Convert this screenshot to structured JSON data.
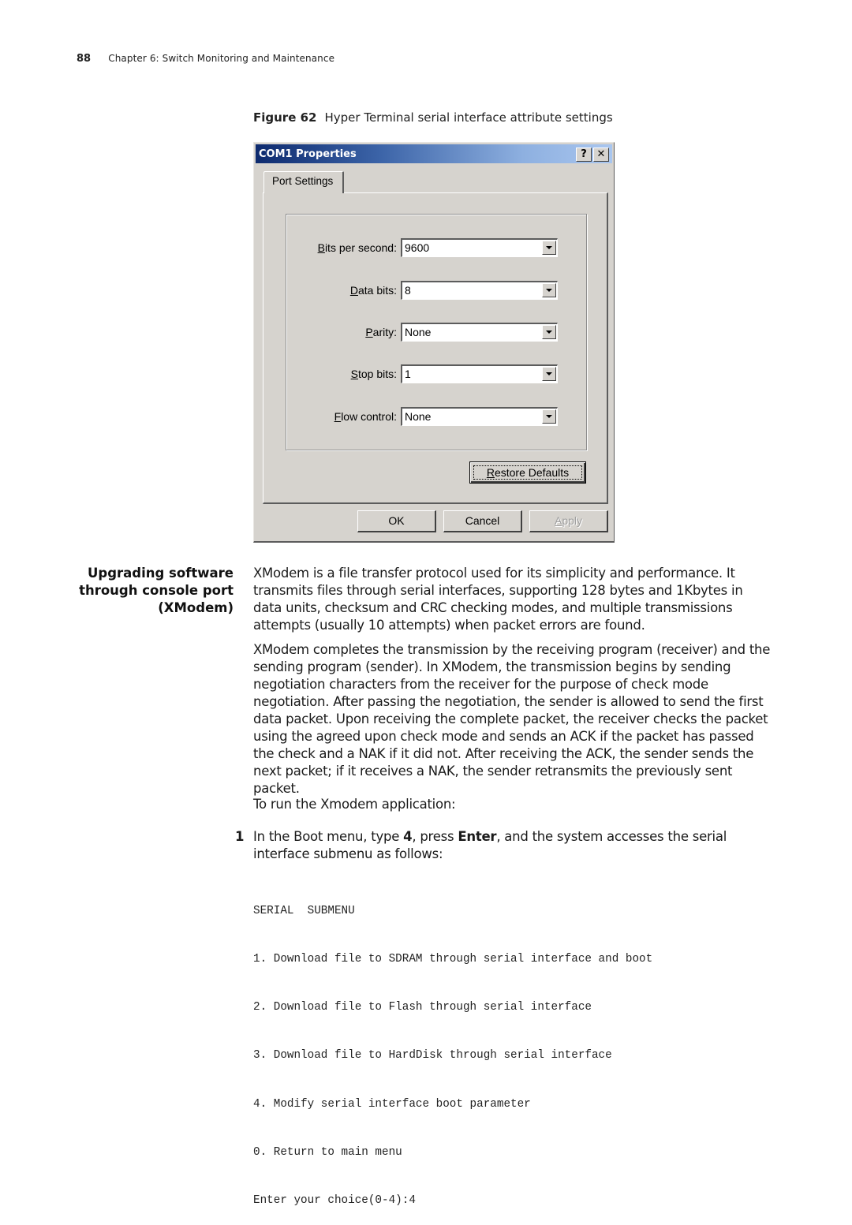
{
  "header": {
    "page_number": "88",
    "chapter": "Chapter 6: Switch Monitoring and Maintenance"
  },
  "figure": {
    "label": "Figure 62",
    "caption": "Hyper Terminal serial interface attribute settings"
  },
  "dialog": {
    "title": "COM1 Properties",
    "help_button": "?",
    "close_button": "✕",
    "tab_label": "Port Settings",
    "fields": [
      {
        "label_accel": "B",
        "label_rest": "its per second:",
        "value": "9600"
      },
      {
        "label_accel": "D",
        "label_rest": "ata bits:",
        "value": "8"
      },
      {
        "label_accel": "P",
        "label_rest": "arity:",
        "value": "None"
      },
      {
        "label_accel": "S",
        "label_rest": "top bits:",
        "value": "1"
      },
      {
        "label_accel": "F",
        "label_rest": "low control:",
        "value": "None"
      }
    ],
    "restore_defaults": {
      "accel": "R",
      "rest": "estore Defaults"
    },
    "ok_label": "OK",
    "cancel_label": "Cancel",
    "apply": {
      "accel": "A",
      "rest": "pply",
      "disabled": true
    }
  },
  "section": {
    "heading_lines": [
      "Upgrading software",
      "through console port",
      "(XModem)"
    ],
    "paragraph1": "XModem is a file transfer protocol used for its simplicity and performance. It transmits files through serial interfaces, supporting 128 bytes and 1Kbytes in data units, checksum and CRC checking modes, and multiple transmissions attempts (usually 10 attempts) when packet errors are found.",
    "paragraph2": "XModem completes the transmission by the receiving program (receiver) and the sending program (sender). In XModem, the transmission begins by sending negotiation characters from the receiver for the purpose of check mode negotiation. After passing the negotiation, the sender is allowed to send the first data packet. Upon receiving the complete packet, the receiver checks the packet using the agreed upon check mode and sends an ACK if the packet has passed the check and a NAK if it did not. After receiving the ACK, the sender sends the next packet; if it receives a NAK, the sender retransmits the previously sent packet.",
    "paragraph3": "To run the Xmodem application:",
    "step1": {
      "number": "1",
      "text_a": "In the Boot menu, type ",
      "bold_a": "4",
      "text_b": ", press ",
      "bold_b": "Enter",
      "text_c": ", and the system accesses the serial interface submenu as follows:"
    },
    "code_lines": [
      "SERIAL  SUBMENU",
      "1. Download file to SDRAM through serial interface and boot",
      "2. Download file to Flash through serial interface",
      "3. Download file to HardDisk through serial interface",
      "4. Modify serial interface boot parameter",
      "0. Return to main menu",
      "Enter your choice(0-4):4"
    ]
  }
}
